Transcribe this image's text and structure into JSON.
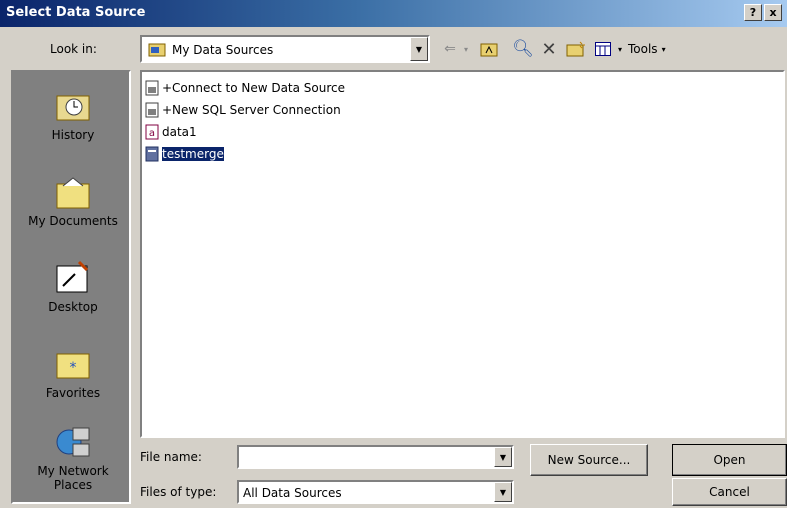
{
  "window": {
    "title": "Select Data Source",
    "help_button": "?",
    "close_button": "x"
  },
  "toolbar": {
    "lookin_label": "Look in:",
    "lookin_value": "My Data Sources",
    "tools_label": "Tools"
  },
  "places": [
    {
      "label": "History",
      "icon": "history-icon"
    },
    {
      "label": "My Documents",
      "icon": "my-documents-icon"
    },
    {
      "label": "Desktop",
      "icon": "desktop-icon"
    },
    {
      "label": "Favorites",
      "icon": "favorites-icon"
    },
    {
      "label": "My Network Places",
      "icon": "network-places-icon"
    }
  ],
  "files": [
    {
      "name": "+Connect to New Data Source",
      "icon": "data-source-icon",
      "selected": false
    },
    {
      "name": "+New SQL Server Connection",
      "icon": "data-source-icon",
      "selected": false
    },
    {
      "name": "data1",
      "icon": "access-file-icon",
      "selected": false
    },
    {
      "name": "testmerge",
      "icon": "db-file-icon",
      "selected": true
    }
  ],
  "bottom": {
    "filename_label": "File name:",
    "filename_value": "",
    "filetype_label": "Files of type:",
    "filetype_value": "All Data Sources",
    "new_source_button": "New Source...",
    "open_button": "Open",
    "cancel_button": "Cancel"
  }
}
